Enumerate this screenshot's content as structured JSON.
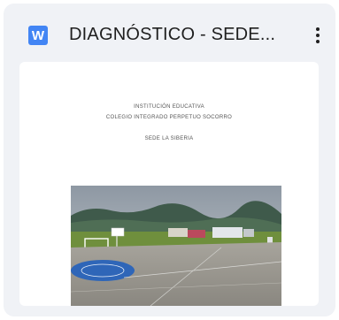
{
  "card": {
    "file_type_letter": "W",
    "title": "DIAGNÓSTICO - SEDE...",
    "file_type_icon": "word-document-icon",
    "menu_icon": "more-vert-icon"
  },
  "document": {
    "line1": "INSTITUCIÓN EDUCATIVA",
    "line2": "COLEGIO INTEGRADO PERPETUO SOCORRO",
    "line3": "SEDE LA SIBERIA"
  },
  "colors": {
    "word_blue": "#4285f4",
    "card_bg": "#f0f2f6"
  }
}
